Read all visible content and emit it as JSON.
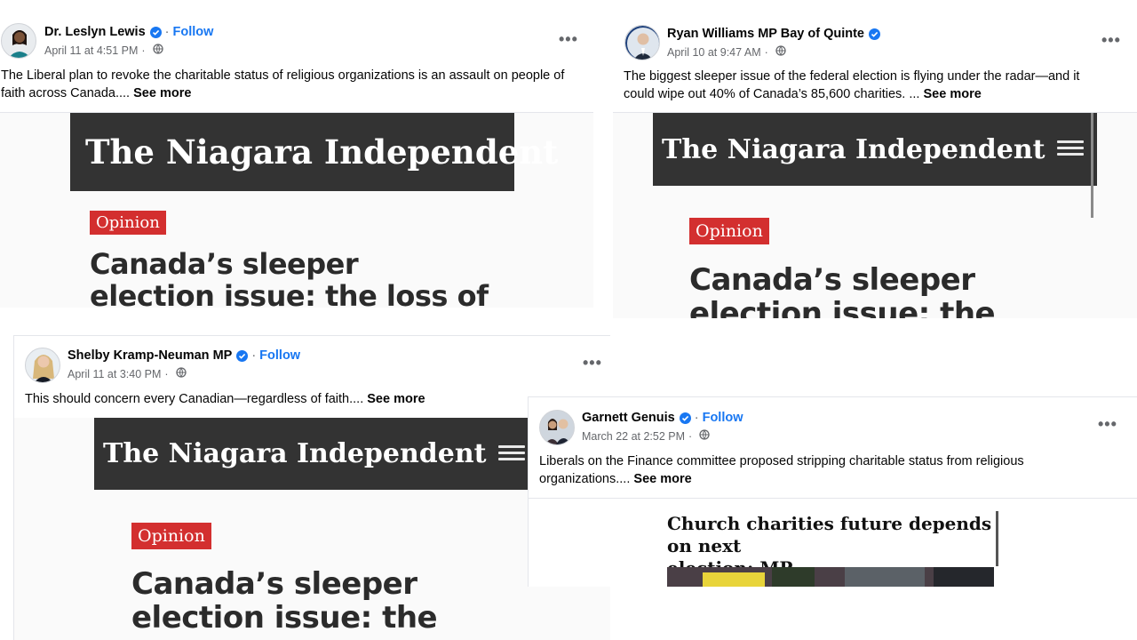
{
  "posts": [
    {
      "author": "Dr. Leslyn Lewis",
      "follow": "Follow",
      "date": "April 11 at 4:51 PM",
      "text_line1": "The Liberal plan to revoke the charitable status of religious organizations is an assault on people of",
      "text_line2": "faith across Canada....",
      "see_more": "See more",
      "masthead": "The Niagara Independent",
      "tag": "Opinion",
      "headline_line1": "Canada’s sleeper",
      "headline_line2": "election issue: the loss of"
    },
    {
      "author": "Ryan Williams MP Bay of Quinte",
      "date": "April 10 at 9:47 AM",
      "text_line1": "The biggest sleeper issue of the federal election is flying under the radar—and it",
      "text_line2": "could wipe out 40% of Canada’s 85,600 charities. ...",
      "see_more": "See more",
      "masthead": "The Niagara Independent",
      "tag": "Opinion",
      "headline_line1": "Canada’s sleeper",
      "headline_line2": "election issue: the"
    },
    {
      "author": "Shelby Kramp-Neuman MP",
      "follow": "Follow",
      "date": "April 11 at 3:40 PM",
      "text_line1": "This should concern every Canadian—regardless of faith....",
      "see_more": "See more",
      "masthead": "The Niagara Independent",
      "tag": "Opinion",
      "headline_line1": "Canada’s sleeper",
      "headline_line2": "election issue: the"
    },
    {
      "author": "Garnett Genuis",
      "follow": "Follow",
      "date": "March 22 at 2:52 PM",
      "text_line1": "Liberals on the Finance committee proposed stripping charitable status from religious",
      "text_line2": "organizations....",
      "see_more": "See more",
      "headline_line1": "Church charities future depends on next",
      "headline_line2": "election: MP"
    }
  ],
  "colors": {
    "link_blue": "#1877f2",
    "meta_gray": "#65676b",
    "masthead_bg": "#333333",
    "opinion_red": "#d32f2f"
  },
  "icons": {
    "verified": "verified-badge-icon",
    "privacy": "globe-icon",
    "more": "more-options-icon",
    "menu": "hamburger-menu-icon"
  },
  "more_glyph": "•••"
}
